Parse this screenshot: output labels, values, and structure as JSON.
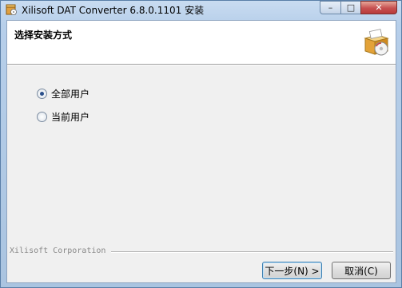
{
  "window": {
    "title": "Xilisoft DAT Converter 6.8.0.1101 安装",
    "min_label": "–",
    "max_label": "□",
    "close_label": "✕"
  },
  "header": {
    "title": "选择安装方式",
    "icon": "installer-box-icon"
  },
  "options": [
    {
      "label": "全部用户",
      "checked": true
    },
    {
      "label": "当前用户",
      "checked": false
    }
  ],
  "footer": {
    "company": "Xilisoft Corporation"
  },
  "buttons": {
    "next": "下一步(N) >",
    "cancel": "取消(C)"
  }
}
